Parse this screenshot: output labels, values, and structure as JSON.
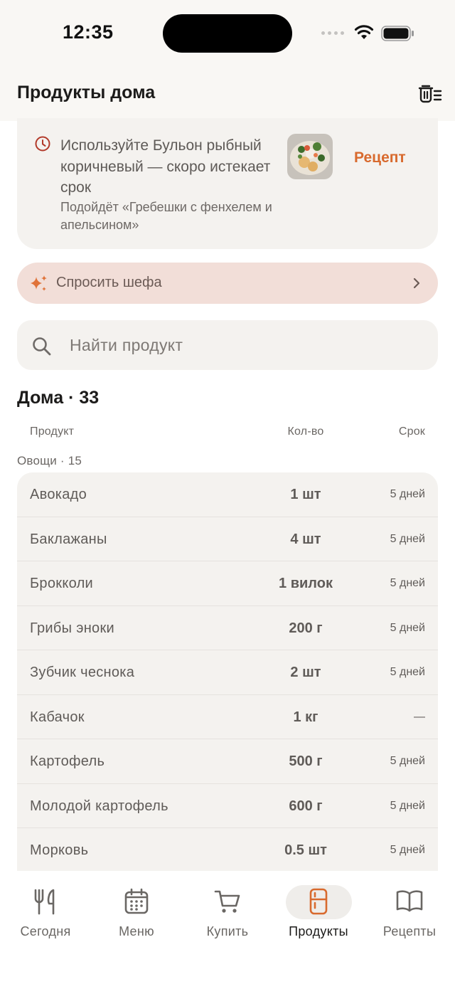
{
  "status": {
    "time": "12:35"
  },
  "header": {
    "title": "Продукты дома",
    "trash_icon": "trash-list-icon"
  },
  "expiry_card": {
    "message": "Используйте Бульон рыбный коричневый — скоро истекает срок",
    "suggestion": "Подойдёт «Гребешки с фенхелем и апельсином»",
    "recipe_label": "Рецепт",
    "icon": "clock-icon",
    "accent_color": "#d86a2e",
    "icon_color": "#b23a2a"
  },
  "chef": {
    "label": "Спросить шефа",
    "icon": "sparkle-icon",
    "bg_color": "#f2ded8"
  },
  "search": {
    "placeholder": "Найти продукт",
    "value": ""
  },
  "inventory": {
    "heading": "Дома · 33",
    "columns": {
      "product": "Продукт",
      "quantity": "Кол-во",
      "expiry": "Срок"
    },
    "group": {
      "label": "Овощи · 15",
      "items": [
        {
          "name": "Авокадо",
          "qty": "1 шт",
          "expiry": "5 дней"
        },
        {
          "name": "Баклажаны",
          "qty": "4 шт",
          "expiry": "5 дней"
        },
        {
          "name": "Брокколи",
          "qty": "1 вилок",
          "expiry": "5 дней"
        },
        {
          "name": "Грибы эноки",
          "qty": "200 г",
          "expiry": "5 дней"
        },
        {
          "name": "Зубчик чеснока",
          "qty": "2 шт",
          "expiry": "5 дней"
        },
        {
          "name": "Кабачок",
          "qty": "1 кг",
          "expiry": "—"
        },
        {
          "name": "Картофель",
          "qty": "500 г",
          "expiry": "5 дней"
        },
        {
          "name": "Молодой картофель",
          "qty": "600 г",
          "expiry": "5 дней"
        },
        {
          "name": "Морковь",
          "qty": "0.5 шт",
          "expiry": "5 дней"
        }
      ]
    }
  },
  "tabs": [
    {
      "label": "Сегодня",
      "icon": "fork-knife-icon"
    },
    {
      "label": "Меню",
      "icon": "calendar-icon"
    },
    {
      "label": "Купить",
      "icon": "cart-icon"
    },
    {
      "label": "Продукты",
      "icon": "fridge-icon",
      "active": true
    },
    {
      "label": "Рецепты",
      "icon": "book-icon"
    }
  ]
}
